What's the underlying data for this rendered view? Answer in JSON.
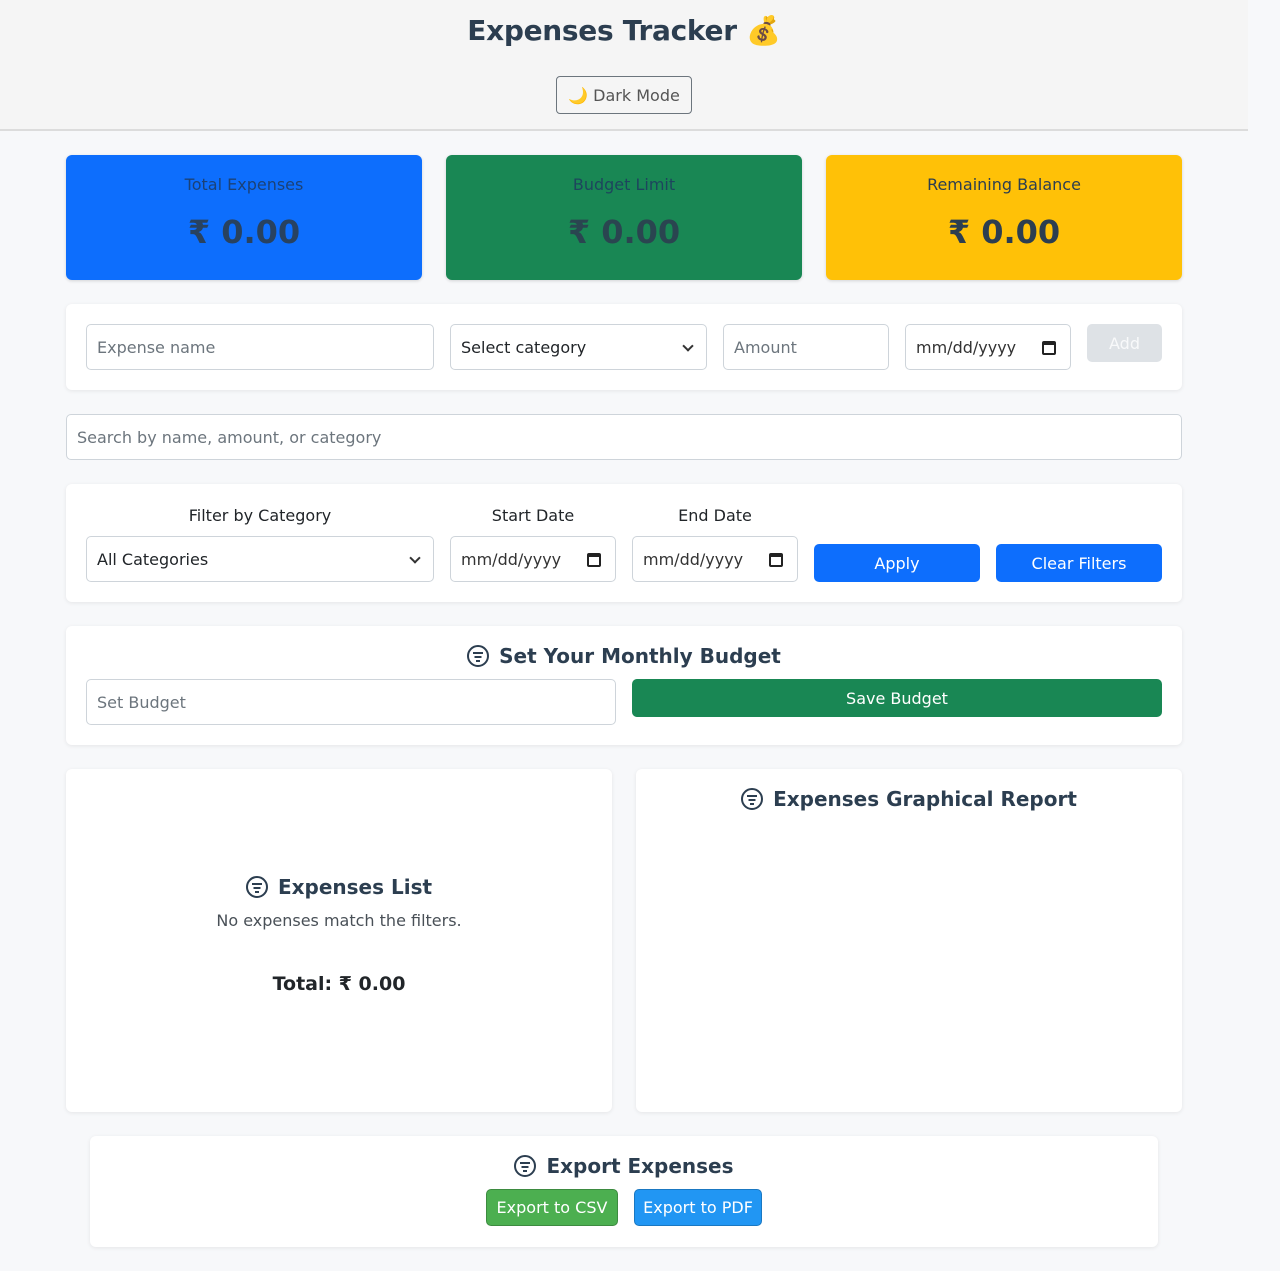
{
  "header": {
    "title": "Expenses Tracker 💰",
    "dark_mode_label": "🌙 Dark Mode"
  },
  "summary": {
    "total_expenses": {
      "label": "Total Expenses",
      "value": "₹ 0.00"
    },
    "budget_limit": {
      "label": "Budget Limit",
      "value": "₹ 0.00"
    },
    "remaining_balance": {
      "label": "Remaining Balance",
      "value": "₹ 0.00"
    }
  },
  "add_form": {
    "name_placeholder": "Expense name",
    "category_selected": "Select category",
    "amount_placeholder": "Amount",
    "date_placeholder": "mm/dd/yyyy",
    "add_label": "Add"
  },
  "search": {
    "placeholder": "Search by name, amount, or category"
  },
  "filters": {
    "category_label": "Filter by Category",
    "category_selected": "All Categories",
    "start_label": "Start Date",
    "start_placeholder": "mm/dd/yyyy",
    "end_label": "End Date",
    "end_placeholder": "mm/dd/yyyy",
    "apply_label": "Apply",
    "clear_label": "Clear Filters"
  },
  "budget": {
    "title": "Set Your Monthly Budget",
    "input_placeholder": "Set Budget",
    "save_label": "Save Budget"
  },
  "expenses_list": {
    "title": "Expenses List",
    "empty_message": "No expenses match the filters.",
    "total": "Total: ₹ 0.00"
  },
  "report": {
    "title": "Expenses Graphical Report"
  },
  "export": {
    "title": "Export Expenses",
    "csv_label": "Export to CSV",
    "pdf_label": "Export to PDF"
  },
  "colors": {
    "primary": "#0d6efd",
    "success": "#198754",
    "warning": "#ffc107",
    "csv": "#4caf50",
    "pdf": "#2196f3"
  },
  "icons": {
    "section_icon": "filter-circle-icon",
    "select_arrow": "chevron-down-icon",
    "date_picker": "calendar-icon"
  }
}
